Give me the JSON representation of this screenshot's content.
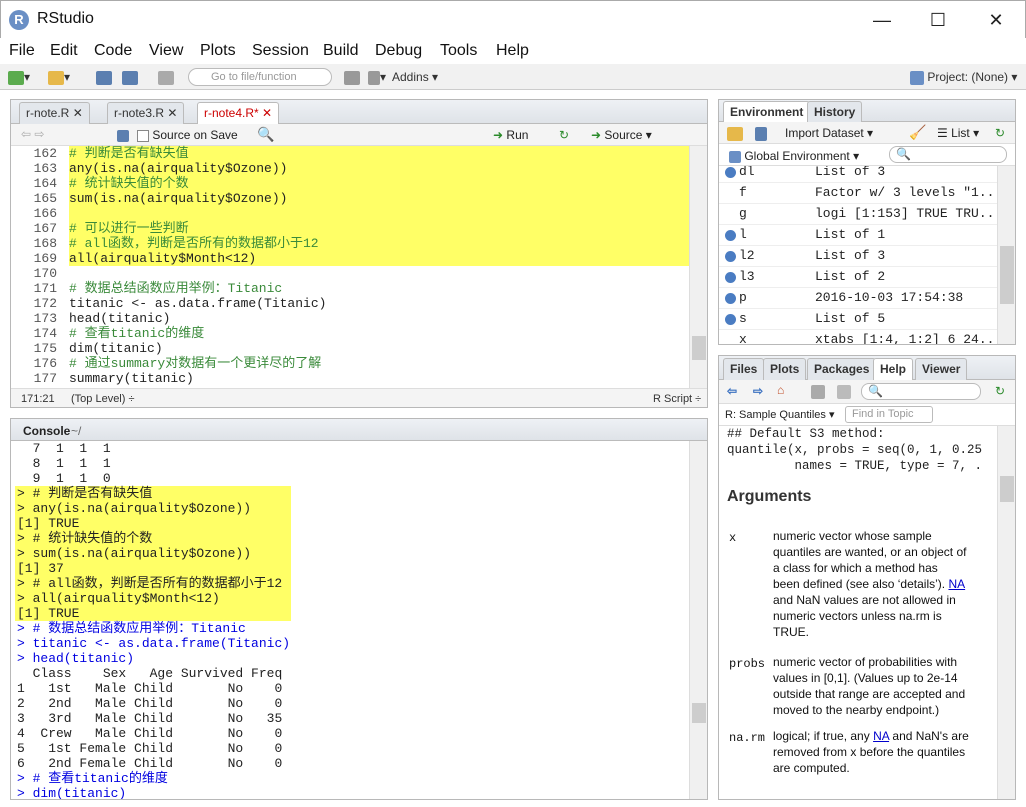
{
  "window": {
    "title": "RStudio",
    "min": "—",
    "max": "☐",
    "close": "✕"
  },
  "menu": [
    "File",
    "Edit",
    "Code",
    "View",
    "Plots",
    "Session",
    "Build",
    "Debug",
    "Tools",
    "Help"
  ],
  "toolbar": {
    "goto": "Go to file/function",
    "addins": "Addins",
    "project": "Project: (None)"
  },
  "editor": {
    "tabs": [
      "r-note.R",
      "r-note3.R",
      "r-note4.R*"
    ],
    "source_on_save": "Source on Save",
    "run": "Run",
    "source": "Source",
    "status_pos": "171:21",
    "status_scope": "(Top Level)",
    "status_type": "R Script",
    "lines": [
      {
        "n": "162",
        "t": "# 判断是否有缺失值",
        "c": true,
        "h": true
      },
      {
        "n": "163",
        "t": "any(is.na(airquality$Ozone))",
        "c": false,
        "h": true
      },
      {
        "n": "164",
        "t": "# 统计缺失值的个数",
        "c": true,
        "h": true
      },
      {
        "n": "165",
        "t": "sum(is.na(airquality$Ozone))",
        "c": false,
        "h": true
      },
      {
        "n": "166",
        "t": "",
        "c": false,
        "h": true
      },
      {
        "n": "167",
        "t": "# 可以进行一些判断",
        "c": true,
        "h": true
      },
      {
        "n": "168",
        "t": "# all函数，判断是否所有的数据都小于12",
        "c": true,
        "h": true
      },
      {
        "n": "169",
        "t": "all(airquality$Month<12)",
        "c": false,
        "h": true
      },
      {
        "n": "170",
        "t": "",
        "c": false,
        "h": false
      },
      {
        "n": "171",
        "t": "# 数据总结函数应用举例：Titanic",
        "c": true,
        "h": false
      },
      {
        "n": "172",
        "t": "titanic <- as.data.frame(Titanic)",
        "c": false,
        "h": false
      },
      {
        "n": "173",
        "t": "head(titanic)",
        "c": false,
        "h": false
      },
      {
        "n": "174",
        "t": "# 查看titanic的维度",
        "c": true,
        "h": false
      },
      {
        "n": "175",
        "t": "dim(titanic)",
        "c": false,
        "h": false
      },
      {
        "n": "176",
        "t": "# 通过summary对数据有一个更详尽的了解",
        "c": true,
        "h": false
      },
      {
        "n": "177",
        "t": "summary(titanic)",
        "c": false,
        "h": false
      }
    ]
  },
  "console": {
    "title": "Console",
    "path": "~/",
    "lines": [
      {
        "t": "  7  1  1  1",
        "k": "out",
        "h": false
      },
      {
        "t": "  8  1  1  1",
        "k": "out",
        "h": false
      },
      {
        "t": "  9  1  1  0",
        "k": "out",
        "h": false
      },
      {
        "t": "> # 判断是否有缺失值",
        "k": "out",
        "h": true
      },
      {
        "t": "> any(is.na(airquality$Ozone))",
        "k": "out",
        "h": true
      },
      {
        "t": "[1] TRUE",
        "k": "out",
        "h": true
      },
      {
        "t": "> # 统计缺失值的个数",
        "k": "out",
        "h": true
      },
      {
        "t": "> sum(is.na(airquality$Ozone))",
        "k": "out",
        "h": true
      },
      {
        "t": "[1] 37",
        "k": "out",
        "h": true
      },
      {
        "t": "> # all函数，判断是否所有的数据都小于12",
        "k": "out",
        "h": true
      },
      {
        "t": "> all(airquality$Month<12)",
        "k": "out",
        "h": true
      },
      {
        "t": "[1] TRUE",
        "k": "out",
        "h": true
      },
      {
        "t": "> # 数据总结函数应用举例：Titanic",
        "k": "cmd",
        "h": false
      },
      {
        "t": "> titanic <- as.data.frame(Titanic)",
        "k": "cmd",
        "h": false
      },
      {
        "t": "> head(titanic)",
        "k": "cmd",
        "h": false
      },
      {
        "t": "  Class    Sex   Age Survived Freq",
        "k": "out",
        "h": false
      },
      {
        "t": "1   1st   Male Child       No    0",
        "k": "out",
        "h": false
      },
      {
        "t": "2   2nd   Male Child       No    0",
        "k": "out",
        "h": false
      },
      {
        "t": "3   3rd   Male Child       No   35",
        "k": "out",
        "h": false
      },
      {
        "t": "4  Crew   Male Child       No    0",
        "k": "out",
        "h": false
      },
      {
        "t": "5   1st Female Child       No    0",
        "k": "out",
        "h": false
      },
      {
        "t": "6   2nd Female Child       No    0",
        "k": "out",
        "h": false
      },
      {
        "t": "> # 查看titanic的维度",
        "k": "cmd",
        "h": false
      },
      {
        "t": "> dim(titanic)",
        "k": "cmd",
        "h": false
      }
    ]
  },
  "env": {
    "tabs": [
      "Environment",
      "History"
    ],
    "import": "Import Dataset",
    "list": "List",
    "global": "Global Environment",
    "rows": [
      {
        "name": "dl",
        "val": "List of 3",
        "dot": true
      },
      {
        "name": "f",
        "val": "Factor w/ 3 levels \"1...",
        "dot": false
      },
      {
        "name": "g",
        "val": "logi [1:153] TRUE TRU...",
        "dot": false
      },
      {
        "name": "l",
        "val": "List of 1",
        "dot": true
      },
      {
        "name": "l2",
        "val": "List of 3",
        "dot": true
      },
      {
        "name": "l3",
        "val": "List of 2",
        "dot": true
      },
      {
        "name": "p",
        "val": "2016-10-03 17:54:38",
        "dot": true
      },
      {
        "name": "s",
        "val": "List of 5",
        "dot": true
      },
      {
        "name": "x",
        "val": "xtabs [1:4, 1:2] 6 24...",
        "dot": false
      }
    ]
  },
  "help": {
    "tabs": [
      "Files",
      "Plots",
      "Packages",
      "Help",
      "Viewer"
    ],
    "topic": "R: Sample Quantiles",
    "find": "Find in Topic",
    "code1": "## Default S3 method:",
    "code2": "quantile(x, probs = seq(0, 1, 0.25",
    "code3": "         names = TRUE, type = 7, .",
    "heading": "Arguments",
    "x_name": "x",
    "x_desc_1": "numeric vector whose sample",
    "x_desc_2": "quantiles are wanted, or an object of",
    "x_desc_3": "a class for which a method has",
    "x_desc_4": "been defined (see also ‘details’).",
    "na": "NA",
    "x_desc_5": "and NaN values are not allowed in",
    "x_desc_6": "numeric vectors unless na.rm is",
    "x_desc_7": "TRUE.",
    "probs_name": "probs",
    "probs_1": "numeric vector of probabilities with",
    "probs_2": "values in [0,1]. (Values up to 2e-14",
    "probs_3": "outside that range are accepted and",
    "probs_4": "moved to the nearby endpoint.)",
    "narm_name": "na.rm",
    "narm_1": "logical; if true, any",
    "narm_1b": "and NaN's are",
    "narm_2": "removed from x before the quantiles",
    "narm_3": "are computed."
  }
}
